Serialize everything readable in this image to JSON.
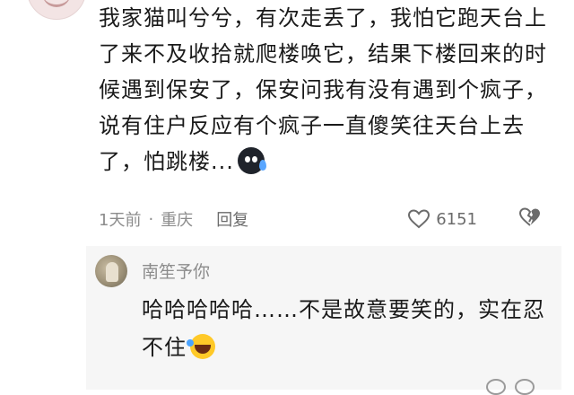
{
  "comment": {
    "text": "我家猫叫兮兮，有次走丢了，我怕它跑天台上了来不及收拾就爬楼唤它，结果下楼回来的时候遇到保安了，保安问我有没有遇到个疯子，说有住户反应有个疯子一直傻笑往天台上去了，怕跳楼...",
    "emoji_icon": "sweat-face-icon",
    "time": "1天前",
    "separator": "·",
    "location": "重庆",
    "reply_label": "回复",
    "like_count": "6151"
  },
  "reply": {
    "username": "南笙予你",
    "text": "哈哈哈哈哈……不是故意要笑的，实在忍不住",
    "emoji_icon": "rolling-laughing-icon"
  },
  "colors": {
    "text": "#1a1a1a",
    "meta": "#8c8c8c",
    "reply_bg": "#f6f6f6"
  }
}
